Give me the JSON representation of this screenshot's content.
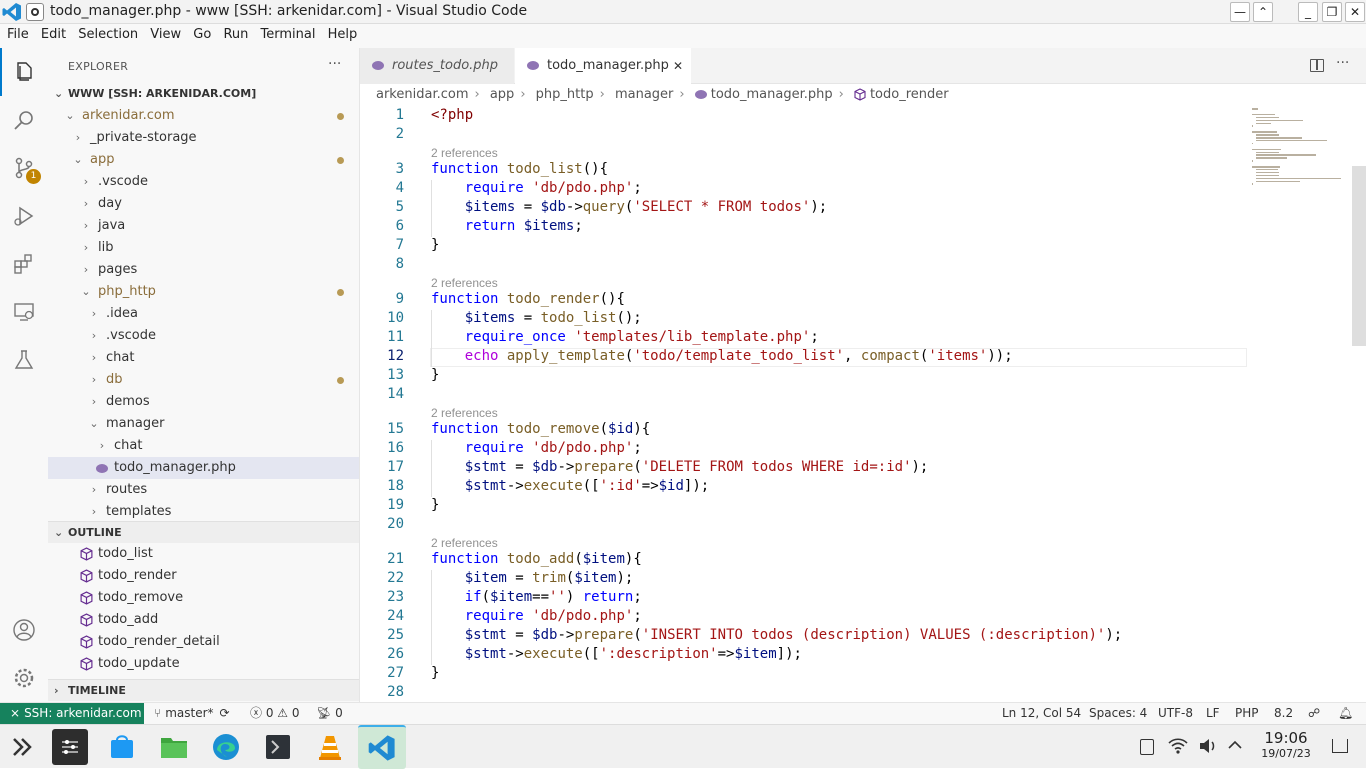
{
  "window": {
    "title": "todo_manager.php - www [SSH: arkenidar.com] - Visual Studio Code"
  },
  "menu": [
    "File",
    "Edit",
    "Selection",
    "View",
    "Go",
    "Run",
    "Terminal",
    "Help"
  ],
  "activity": {
    "scm_badge": "1"
  },
  "explorer": {
    "title": "EXPLORER",
    "more": "···",
    "workspace": "WWW [SSH: ARKENIDAR.COM]",
    "tree": [
      {
        "label": "arkenidar.com",
        "indent": 0,
        "open": true,
        "dot": true,
        "color": "#8a6d3b"
      },
      {
        "label": "_private-storage",
        "indent": 1,
        "open": false
      },
      {
        "label": "app",
        "indent": 1,
        "open": true,
        "dot": true,
        "color": "#8a6d3b"
      },
      {
        "label": ".vscode",
        "indent": 2,
        "open": false
      },
      {
        "label": "day",
        "indent": 2,
        "open": false
      },
      {
        "label": "java",
        "indent": 2,
        "open": false
      },
      {
        "label": "lib",
        "indent": 2,
        "open": false
      },
      {
        "label": "pages",
        "indent": 2,
        "open": false
      },
      {
        "label": "php_http",
        "indent": 2,
        "open": true,
        "dot": true,
        "color": "#8a6d3b"
      },
      {
        "label": ".idea",
        "indent": 3,
        "open": false
      },
      {
        "label": ".vscode",
        "indent": 3,
        "open": false
      },
      {
        "label": "chat",
        "indent": 3,
        "open": false
      },
      {
        "label": "db",
        "indent": 3,
        "open": false,
        "dot": true,
        "color": "#8a6d3b"
      },
      {
        "label": "demos",
        "indent": 3,
        "open": false
      },
      {
        "label": "manager",
        "indent": 3,
        "open": true
      },
      {
        "label": "chat",
        "indent": 4,
        "open": false
      },
      {
        "label": "todo_manager.php",
        "indent": 4,
        "file": true,
        "selected": true
      },
      {
        "label": "routes",
        "indent": 3,
        "open": false
      },
      {
        "label": "templates",
        "indent": 3,
        "open": false
      }
    ]
  },
  "outline": {
    "title": "OUTLINE",
    "items": [
      "todo_list",
      "todo_render",
      "todo_remove",
      "todo_add",
      "todo_render_detail",
      "todo_update"
    ]
  },
  "timeline": {
    "title": "TIMELINE"
  },
  "tabs": [
    {
      "label": "routes_todo.php",
      "active": false
    },
    {
      "label": "todo_manager.php",
      "active": true,
      "close": "✕"
    }
  ],
  "breadcrumb": [
    "arkenidar.com",
    "app",
    "php_http",
    "manager",
    "todo_manager.php",
    "todo_render"
  ],
  "editor": {
    "lens": "2 references",
    "lines": [
      "<?php",
      "",
      "function todo_list(){",
      "    require 'db/pdo.php';",
      "    $items = $db->query('SELECT * FROM todos');",
      "    return $items;",
      "}",
      "",
      "function todo_render(){",
      "    $items = todo_list();",
      "    require_once 'templates/lib_template.php';",
      "    echo apply_template('todo/template_todo_list', compact('items'));",
      "}",
      "",
      "function todo_remove($id){",
      "    require 'db/pdo.php';",
      "    $stmt = $db->prepare('DELETE FROM todos WHERE id=:id');",
      "    $stmt->execute([':id'=>$id]);",
      "}",
      "",
      "function todo_add($item){",
      "    $item = trim($item);",
      "    if($item=='') return;",
      "    require 'db/pdo.php';",
      "    $stmt = $db->prepare('INSERT INTO todos (description) VALUES (:description)');",
      "    $stmt->execute([':description'=>$item]);",
      "}",
      ""
    ],
    "lens_before_lines": [
      3,
      9,
      15,
      21
    ]
  },
  "status": {
    "remote": "SSH: arkenidar.com",
    "branch": "master*",
    "errors": "0",
    "warnings": "0",
    "ports": "0",
    "position": "Ln 12, Col 54",
    "spaces": "Spaces: 4",
    "encoding": "UTF-8",
    "eol": "LF",
    "language": "PHP",
    "version": "8.2"
  },
  "taskbar": {
    "time": "19:06",
    "date": "19/07/23"
  },
  "colors": {
    "accent": "#007acc",
    "remote": "#16825d",
    "selection": "#e4e6f1"
  }
}
